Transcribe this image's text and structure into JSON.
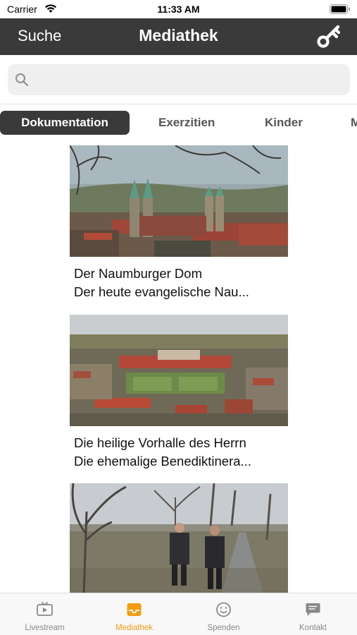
{
  "status_bar": {
    "carrier": "Carrier",
    "time": "11:33 AM"
  },
  "nav": {
    "back_label": "Suche",
    "title": "Mediathek",
    "key_icon": "key-icon"
  },
  "search": {
    "placeholder": "",
    "value": "",
    "icon": "search-icon"
  },
  "tabs": [
    {
      "label": "Dokumentation",
      "active": true
    },
    {
      "label": "Exerzitien",
      "active": false
    },
    {
      "label": "Kinder",
      "active": false
    },
    {
      "label": "M",
      "active": false
    }
  ],
  "media": [
    {
      "title": "Der Naumburger Dom",
      "description": "Der heute evangelische Nau..."
    },
    {
      "title": "Die heilige Vorhalle des Herrn",
      "description": "Die ehemalige Benediktinera..."
    },
    {
      "title": "",
      "description": ""
    }
  ],
  "tabbar": [
    {
      "label": "Livestream",
      "icon": "tv-icon",
      "active": false
    },
    {
      "label": "Mediathek",
      "icon": "inbox-icon",
      "active": true
    },
    {
      "label": "Spenden",
      "icon": "smiley-icon",
      "active": false
    },
    {
      "label": "Kontakt",
      "icon": "chat-icon",
      "active": false
    }
  ],
  "colors": {
    "nav_bg": "#3a3a3a",
    "accent": "#f39c12",
    "tab_inactive": "#888888"
  }
}
